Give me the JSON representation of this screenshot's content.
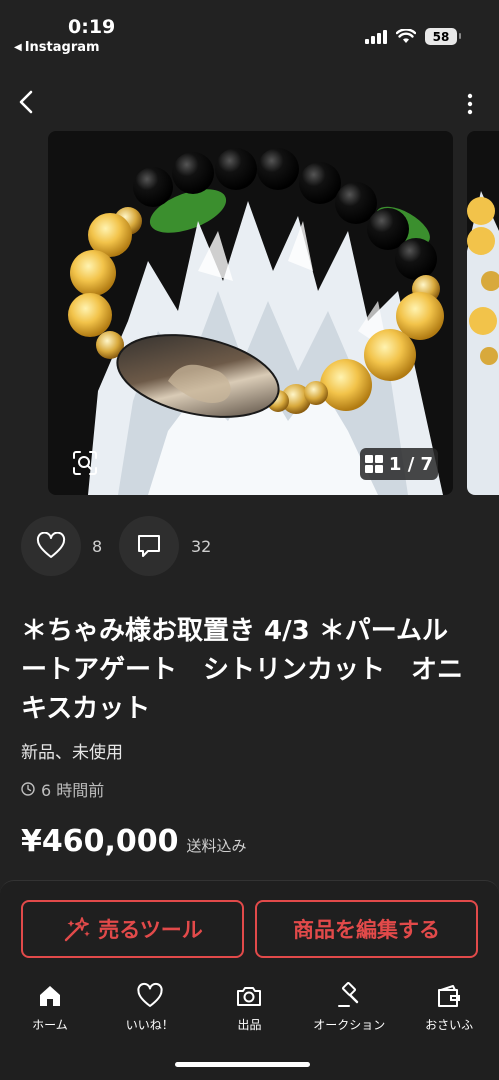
{
  "status_bar": {
    "time": "0:19",
    "back_app": "Instagram",
    "battery": "58"
  },
  "gallery": {
    "counter": "1 / 7"
  },
  "reactions": {
    "likes": "8",
    "comments": "32"
  },
  "item": {
    "title": "＊ちゃみ様お取置き 4/3 ＊パームルートアゲート　シトリンカット　オニキスカット",
    "condition": "新品、未使用",
    "posted": "6 時間前",
    "price": "¥460,000",
    "shipping": "送料込み"
  },
  "actions": {
    "sell_tool": "売るツール",
    "edit_item": "商品を編集する"
  },
  "tabs": [
    {
      "label": "ホーム",
      "icon": "home-icon"
    },
    {
      "label": "いいね！",
      "icon": "heart-icon"
    },
    {
      "label": "出品",
      "icon": "camera-icon"
    },
    {
      "label": "オークション",
      "icon": "auction-hammer-icon"
    },
    {
      "label": "おさいふ",
      "icon": "wallet-icon"
    }
  ],
  "colors": {
    "background": "#222222",
    "accent": "#e24a4a",
    "text": "#ffffff"
  }
}
